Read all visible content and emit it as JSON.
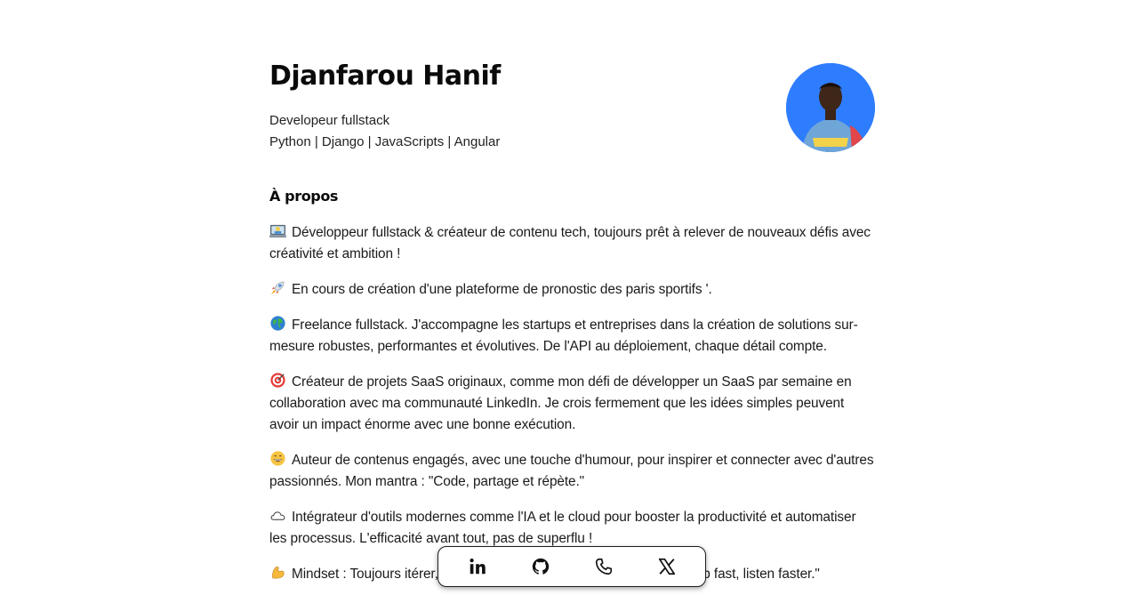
{
  "profile": {
    "name": "Djanfarou Hanif",
    "role": "Developeur fullstack",
    "stack": "Python | Django | JavaScripts | Angular",
    "avatar_bg": "#2f7dff"
  },
  "about": {
    "title": "À propos",
    "paragraphs": [
      {
        "icon": "laptop-dev-emoji",
        "text": "Développeur fullstack & créateur de contenu tech, toujours prêt à relever de nouveaux défis avec créativité et ambition !"
      },
      {
        "icon": "rocket-emoji",
        "text": "En cours de création d'une plateforme de pronostic des paris sportifs '."
      },
      {
        "icon": "globe-emoji",
        "text": "Freelance fullstack. J'accompagne les startups et entreprises dans la création de solutions sur-mesure robustes, performantes et évolutives. De l'API au déploiement, chaque détail compte."
      },
      {
        "icon": "target-emoji",
        "text": "Créateur de projets SaaS originaux, comme mon défi de développer un SaaS par semaine en collaboration avec ma communauté LinkedIn. Je crois fermement que les idées simples peuvent avoir un impact énorme avec une bonne exécution."
      },
      {
        "icon": "grinning-emoji",
        "text": "Auteur de contenus engagés, avec une touche d'humour, pour inspirer et connecter avec d'autres passionnés. Mon mantra : \"Code, partage et répète.\""
      },
      {
        "icon": "cloud-emoji",
        "text": "Intégrateur d'outils modernes comme l'IA et le cloud pour booster la productivité et automatiser les processus. L'efficacité avant tout, pas de superflu !"
      },
      {
        "icon": "flexed-biceps-emoji",
        "text": "Mindset : Toujours itérer, tester, améliorer. Ma devise : \"Build fast, ship fast, listen faster.\""
      }
    ]
  },
  "dock": {
    "items": [
      {
        "icon": "linkedin-icon"
      },
      {
        "icon": "github-icon"
      },
      {
        "icon": "phone-icon"
      },
      {
        "icon": "x-icon"
      }
    ]
  }
}
